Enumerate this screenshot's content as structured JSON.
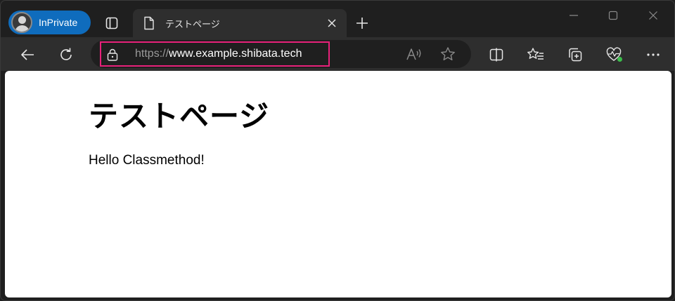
{
  "browser": {
    "profile_label": "InPrivate",
    "tab": {
      "title": "テストページ"
    },
    "address": {
      "protocol": "https://",
      "host": "www.example.shibata.tech"
    },
    "colors": {
      "accent": "#0f6cbd",
      "highlight": "#e8217a",
      "tracking_dot": "#3bbd4b"
    }
  },
  "page": {
    "heading": "テストページ",
    "paragraph": "Hello Classmethod!"
  }
}
